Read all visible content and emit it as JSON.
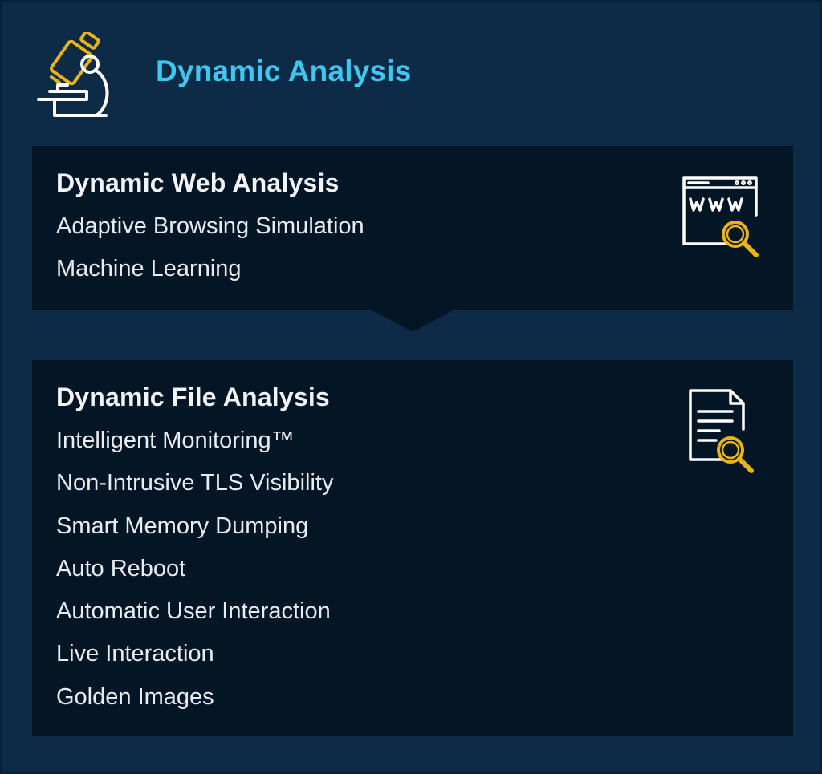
{
  "header": {
    "title": "Dynamic Analysis",
    "icon": "microscope-icon"
  },
  "colors": {
    "panel_background": "#0d2a46",
    "card_background": "#041526",
    "title_accent": "#3fc7f0",
    "icon_accent": "#e9b31a",
    "text": "#e9edf2"
  },
  "web_analysis": {
    "title": "Dynamic Web Analysis",
    "icon": "browser-www-search-icon",
    "features": [
      "Adaptive Browsing Simulation",
      "Machine Learning"
    ]
  },
  "file_analysis": {
    "title": "Dynamic File Analysis",
    "icon": "document-search-icon",
    "features": [
      "Intelligent Monitoring™",
      "Non-Intrusive TLS Visibility",
      "Smart Memory Dumping",
      "Auto Reboot",
      "Automatic User Interaction",
      "Live Interaction",
      "Golden Images"
    ]
  }
}
